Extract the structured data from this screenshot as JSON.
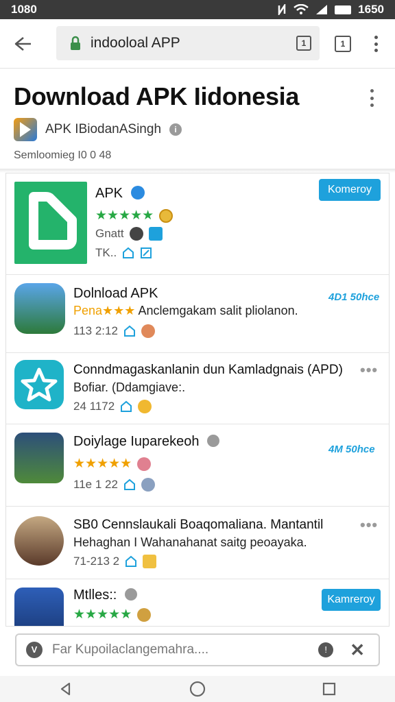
{
  "status_bar": {
    "time": "1080",
    "clock_right": "1650"
  },
  "browser": {
    "url": "indooloal APP",
    "tab_count": "1",
    "tab_btn": "1"
  },
  "header": {
    "title": "Download APK Iidonesia",
    "developer": "APK IBiodanASingh",
    "meta": "Semloomieg I0 0 48"
  },
  "apps": [
    {
      "name": "APK",
      "stars": "★★★★★",
      "line2": "Gnatt",
      "line3": "TK..",
      "button": "Komeroy",
      "icon_color": "#24b36b"
    },
    {
      "name": "Dolnload APK",
      "rating_text": "Pena★★★",
      "subtitle": "Anclemgakam salit pliolanon.",
      "meta": "113 2:12",
      "tag": "4D1 50hce"
    },
    {
      "name": "Conndmagaskanlanin dun Kamladgnais (APD)",
      "subtitle": "Bofiar. (Ddamgiave:.",
      "meta": "24 1172",
      "more": "•••"
    },
    {
      "name": "Doiylage Iuparekeoh",
      "stars": "★★★★★",
      "meta": "11e 1 22",
      "tag": "4M 50hce"
    },
    {
      "name": "SB0 Cennslaukali Boaqomaliana. Mantantil",
      "subtitle": "Hehaghan I Wahanahanat saitg peoayaka.",
      "meta": "71-213 2",
      "more": "•••"
    },
    {
      "name": "Mtlles::",
      "stars": "★★★★★",
      "button": "Kamreroy"
    }
  ],
  "search": {
    "placeholder": "Far Kupoilaclangemahra...."
  },
  "colors": {
    "accent": "#1ea1dc",
    "green": "#27a844",
    "orange": "#f0a000"
  }
}
